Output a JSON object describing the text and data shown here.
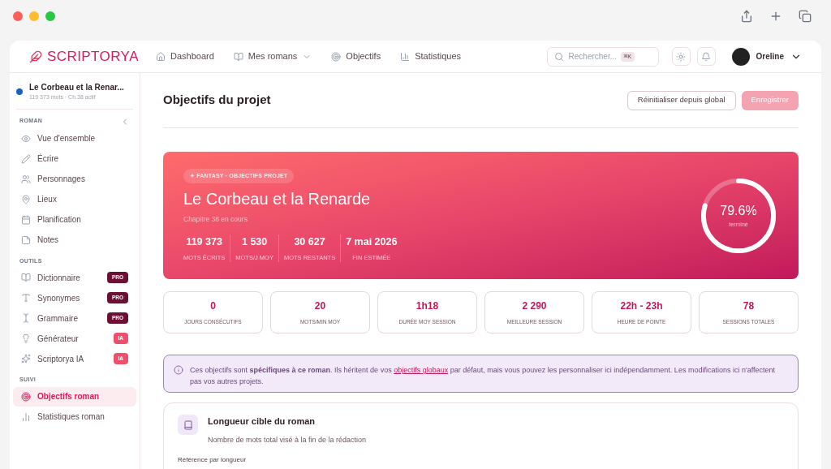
{
  "brand": {
    "name": "SCRIPTORYA"
  },
  "nav": [
    {
      "label": "Dashboard",
      "dropdown": false
    },
    {
      "label": "Mes romans",
      "dropdown": true
    },
    {
      "label": "Objectifs",
      "dropdown": false
    },
    {
      "label": "Statistiques",
      "dropdown": false
    }
  ],
  "search": {
    "placeholder": "Rechercher...",
    "shortcut": "⌘K"
  },
  "user": {
    "name": "Oreline"
  },
  "project": {
    "title": "Le Corbeau et la Renar...",
    "meta": "119 373 mots · Ch.38 actif",
    "color": "#1565c0"
  },
  "sidebar": [
    {
      "heading": "ROMAN",
      "collapsible": true,
      "items": [
        {
          "label": "Vue d'ensemble",
          "selected": false
        },
        {
          "label": "Écrire",
          "selected": false
        },
        {
          "label": "Personnages",
          "selected": false
        },
        {
          "label": "Lieux",
          "selected": false
        },
        {
          "label": "Planification",
          "selected": false
        },
        {
          "label": "Notes",
          "selected": false
        }
      ]
    },
    {
      "heading": "OUTILS",
      "collapsible": false,
      "items": [
        {
          "label": "Dictionnaire",
          "selected": false,
          "badge": {
            "text": "PRO",
            "kind": "pro"
          }
        },
        {
          "label": "Synonymes",
          "selected": false,
          "badge": {
            "text": "PRO",
            "kind": "pro"
          }
        },
        {
          "label": "Grammaire",
          "selected": false,
          "badge": {
            "text": "PRO",
            "kind": "pro"
          }
        },
        {
          "label": "Générateur",
          "selected": false,
          "badge": {
            "text": "IA",
            "kind": "ia"
          }
        },
        {
          "label": "Scriptorya IA",
          "selected": false,
          "badge": {
            "text": "IA",
            "kind": "ia"
          }
        }
      ]
    },
    {
      "heading": "SUIVI",
      "collapsible": false,
      "items": [
        {
          "label": "Objectifs roman",
          "selected": true
        },
        {
          "label": "Statistiques roman",
          "selected": false
        }
      ]
    }
  ],
  "page": {
    "title": "Objectifs du projet",
    "buttons": [
      {
        "label": "Réinitialiser depuis global",
        "kind": "secondary",
        "disabled": false
      },
      {
        "label": "Enregistrer",
        "kind": "primary",
        "disabled": true
      }
    ]
  },
  "hero": {
    "tag": "✦ FANTASY · OBJECTIFS PROJET",
    "title": "Le Corbeau et la Renarde",
    "subtitle": "Chapitre 38 en cours",
    "stats": [
      {
        "value": "119 373",
        "label": "MOTS ÉCRITS"
      },
      {
        "value": "1 530",
        "label": "MOTS/J MOY"
      },
      {
        "value": "30 627",
        "label": "MOTS RESTANTS"
      },
      {
        "value": "7 mai 2026",
        "label": "FIN ESTIMÉE"
      }
    ],
    "progress": {
      "level": 0.796,
      "reading": "79.6%",
      "caption": "terminé"
    }
  },
  "metrics": [
    {
      "value": "0",
      "label": "JOURS CONSÉCUTIFS"
    },
    {
      "value": "20",
      "label": "MOTS/MIN MOY"
    },
    {
      "value": "1h18",
      "label": "DURÉE MOY SESSION"
    },
    {
      "value": "2 290",
      "label": "MEILLEURE SESSION"
    },
    {
      "value": "22h - 23h",
      "label": "HEURE DE POINTE"
    },
    {
      "value": "78",
      "label": "SESSIONS TOTALES"
    }
  ],
  "info": {
    "before": "Ces objectifs sont **spécifiques à ce roman**. Ils héritent de vos",
    "link": "objectifs globaux",
    "after": "par défaut, mais vous pouvez les personnaliser ici indépendamment. Les modifications ici n'affectent pas vos autres projets."
  },
  "section": {
    "title": "Longueur cible du roman",
    "description": "Nombre de mots total visé à la fin de la rédaction",
    "field_label": "Référence par longueur"
  }
}
